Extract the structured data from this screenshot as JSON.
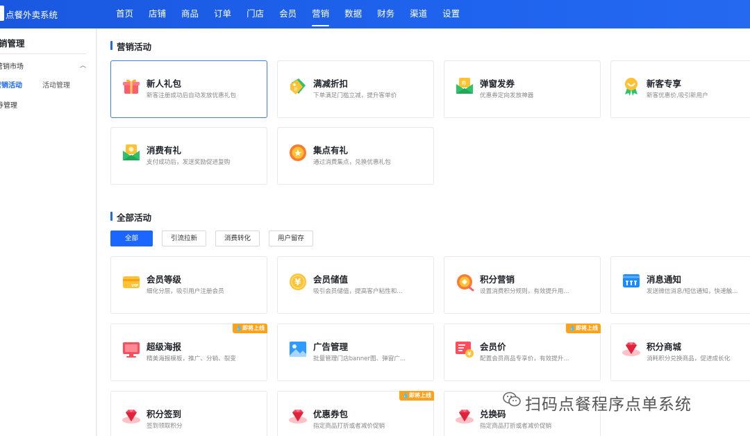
{
  "app": {
    "title": "点餐外卖系统"
  },
  "nav": {
    "items": [
      "首页",
      "店铺",
      "商品",
      "订单",
      "门店",
      "会员",
      "营销",
      "数据",
      "财务",
      "渠道",
      "设置"
    ],
    "active": "营销"
  },
  "sidebar": {
    "title": "销管理",
    "group": "营销市场",
    "active_item": "营销活动",
    "sub_item": "活动管理",
    "item": "券管理"
  },
  "marketing": {
    "title": "营销活动",
    "cards": [
      {
        "title": "新人礼包",
        "desc": "新客注册成功后自动发放优惠礼包",
        "icon": "gift-icon"
      },
      {
        "title": "满减折扣",
        "desc": "下单满足门槛立减，提升客单价",
        "icon": "discount-tag-icon"
      },
      {
        "title": "弹窗发券",
        "desc": "优惠券定向发放神器",
        "icon": "coupon-envelope-icon"
      },
      {
        "title": "新客专享",
        "desc": "新客优惠价,吸引新用户",
        "icon": "new-customer-badge-icon"
      },
      {
        "title": "消费有礼",
        "desc": "支付成功后，发送奖励促进复购",
        "icon": "reward-envelope-icon"
      },
      {
        "title": "集点有礼",
        "desc": "通过消费集点，兑换优惠礼包",
        "icon": "points-coin-icon"
      }
    ]
  },
  "all": {
    "title": "全部活动",
    "filters": [
      "全部",
      "引流拉新",
      "消费转化",
      "用户留存"
    ],
    "active_filter": "全部",
    "coming_soon": "即将上线",
    "cards": [
      {
        "title": "会员等级",
        "desc": "细化分层，吸引用户注册会员",
        "icon": "vip-card-icon",
        "soon": false
      },
      {
        "title": "会员储值",
        "desc": "吸引会员储值，提高客户粘性和...",
        "icon": "yuan-coin-icon",
        "soon": false
      },
      {
        "title": "积分营销",
        "desc": "设置消费积分规则，有效提升用...",
        "icon": "points-icon",
        "soon": false
      },
      {
        "title": "消息通知",
        "desc": "发送微信消息/短信通知，快速触...",
        "icon": "message-icon",
        "soon": false
      },
      {
        "title": "超级海报",
        "desc": "精美海报模板，推广、分销、裂变",
        "icon": "poster-monitor-icon",
        "soon": true
      },
      {
        "title": "广告管理",
        "desc": "批量管理门店banner图、弹窗广...",
        "icon": "ad-image-icon",
        "soon": false
      },
      {
        "title": "会员价",
        "desc": "配置会员商品专享价，有效提升...",
        "icon": "member-price-icon",
        "soon": true
      },
      {
        "title": "积分商城",
        "desc": "消耗积分兑换商品，促进成长化",
        "icon": "gem-icon",
        "soon": false
      },
      {
        "title": "积分签到",
        "desc": "签到领取积分",
        "icon": "gem-icon",
        "soon": false
      },
      {
        "title": "优惠券包",
        "desc": "指定商品打折或者减价促销",
        "icon": "gem-icon",
        "soon": true
      },
      {
        "title": "兑换码",
        "desc": "指定商品打折或者减价促销",
        "icon": "gem-icon",
        "soon": false
      }
    ]
  },
  "watermark": {
    "text": "扫码点餐程序点单系统",
    "icon": "wechat-icon"
  },
  "colors": {
    "primary": "#1a66ff",
    "topbar": "#1e63ee",
    "badge": "#ffa21a"
  }
}
